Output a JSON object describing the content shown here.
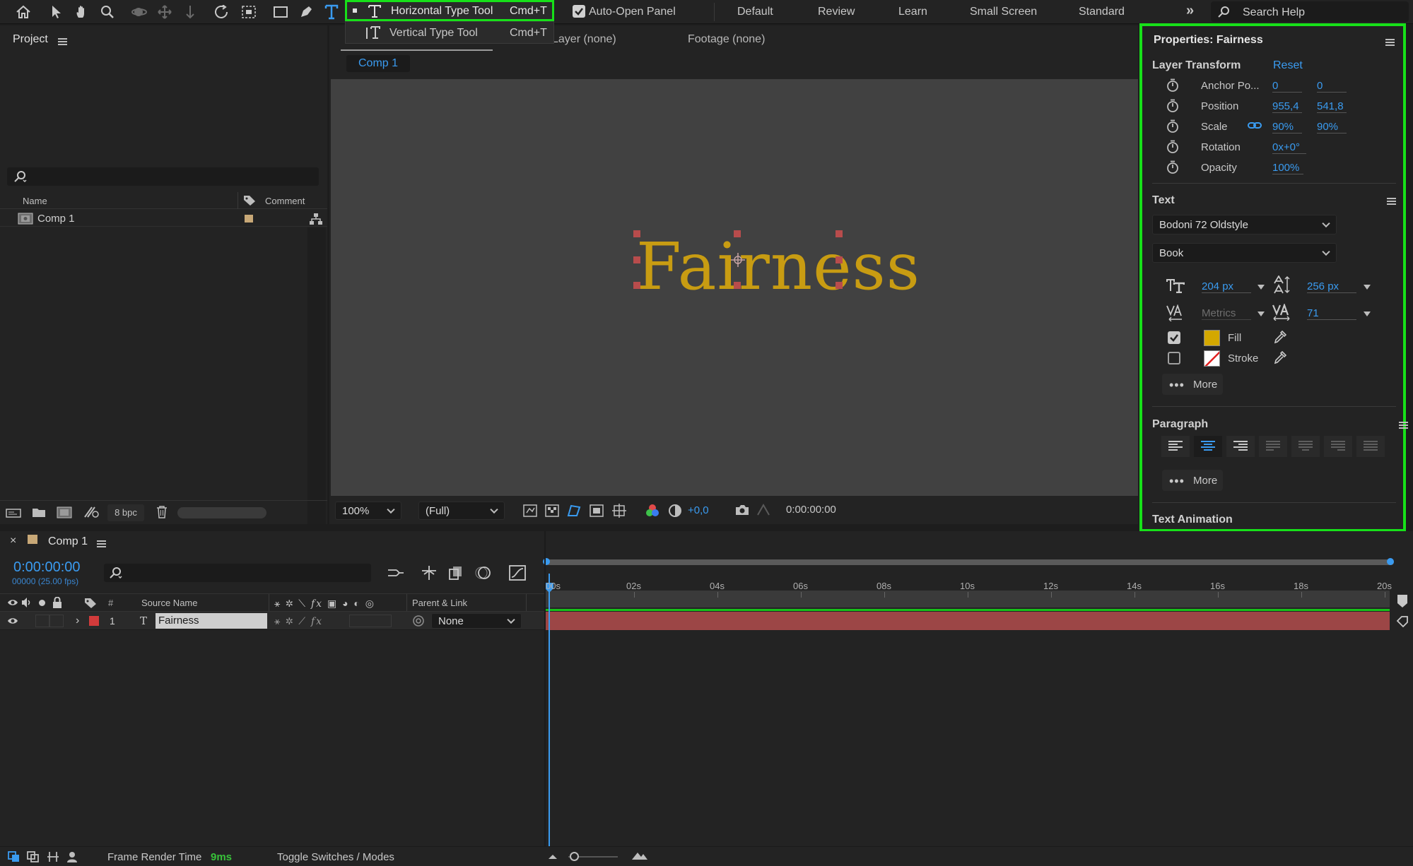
{
  "topbar": {
    "type_tool_menu": {
      "horizontal": {
        "label": "Horizontal Type Tool",
        "shortcut": "Cmd+T"
      },
      "vertical": {
        "label": "Vertical Type Tool",
        "shortcut": "Cmd+T"
      }
    },
    "auto_open_panel": "Auto-Open Panel",
    "workspaces": [
      "Default",
      "Review",
      "Learn",
      "Small Screen",
      "Standard"
    ],
    "search_placeholder": "Search Help"
  },
  "project": {
    "title": "Project",
    "columns": {
      "name": "Name",
      "comment": "Comment"
    },
    "items": [
      {
        "name": "Comp 1"
      }
    ],
    "bpc": "8 bpc"
  },
  "viewer": {
    "tabs": {
      "layer": "Layer (none)",
      "footage": "Footage (none)"
    },
    "comp_tab": "Comp 1",
    "text": "Fairness",
    "zoom": "100%",
    "resolution": "(Full)",
    "exposure": "+0,0",
    "timecode": "0:00:00:00"
  },
  "properties": {
    "title": "Properties: Fairness",
    "layer_transform": "Layer Transform",
    "reset": "Reset",
    "rows": [
      {
        "label": "Anchor Po...",
        "v1": "0",
        "v2": "0"
      },
      {
        "label": "Position",
        "v1": "955,4",
        "v2": "541,8"
      },
      {
        "label": "Scale",
        "v1": "90%",
        "v2": "90%"
      },
      {
        "label": "Rotation",
        "v1": "0x+0°",
        "v2": ""
      },
      {
        "label": "Opacity",
        "v1": "100%",
        "v2": ""
      }
    ],
    "text_section": "Text",
    "font_family": "Bodoni 72 Oldstyle",
    "font_style": "Book",
    "font_size": "204 px",
    "leading": "256 px",
    "kerning": "Metrics",
    "tracking": "71",
    "fill_label": "Fill",
    "stroke_label": "Stroke",
    "more_label": "More",
    "paragraph": "Paragraph",
    "text_animation": "Text Animation",
    "fill_color": "#d4a800"
  },
  "timeline": {
    "comp_tab": "Comp 1",
    "timecode": "0:00:00:00",
    "fps": "00000 (25.00 fps)",
    "columns": {
      "hash": "#",
      "source": "Source Name",
      "parent": "Parent & Link"
    },
    "layer": {
      "index": "1",
      "name": "Fairness",
      "parent": "None"
    },
    "ticks": [
      "00s",
      "02s",
      "04s",
      "06s",
      "08s",
      "10s",
      "12s",
      "14s",
      "16s",
      "18s",
      "20s"
    ],
    "footer": {
      "render_label": "Frame Render Time",
      "render_value": "9ms",
      "toggle": "Toggle Switches / Modes"
    }
  }
}
